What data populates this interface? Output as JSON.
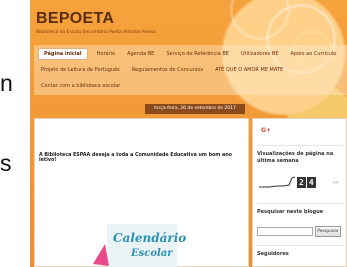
{
  "slide_fragments": [
    "n",
    "s"
  ],
  "blog": {
    "title": "BEPOETA",
    "subtitle": "Biblioteca da Escola Secundária Poeta Antonio Aleixo",
    "nav_row1": [
      "Página inicial",
      "Horário",
      "Agenda BE",
      "Serviço de Referência BE",
      "Utilizadores BE",
      "Apoio ao Currículo"
    ],
    "nav_row2": [
      "Projeto de Leitura de Português",
      "Regulamentos de Concursos",
      "ATÉ QUE O AMOR ME MATE"
    ],
    "nav_row3": [
      "Contar com a biblioteca escolar"
    ],
    "active_nav": 0,
    "date": "terça-feira, 26 de setembro de 2017",
    "post_title": "A Biblioteca ESPAA deseja a toda a Comunidade Educativa um bom ano letivo!",
    "post_image_text": [
      "Calendário",
      "Escolar"
    ]
  },
  "sidebar": {
    "gplus": "G+",
    "views_heading": "Visualizações de página na última semana",
    "counter_digits": [
      "2",
      "4"
    ],
    "search_heading": "Pesquisar neste blogue",
    "search_placeholder": "",
    "search_button": "Pesquisar",
    "followers_heading": "Seguidores"
  },
  "colors": {
    "background": "#f29a38",
    "title": "#5a2d0a",
    "date_bar": "#8a4a1a",
    "gplus": "#d34836"
  }
}
